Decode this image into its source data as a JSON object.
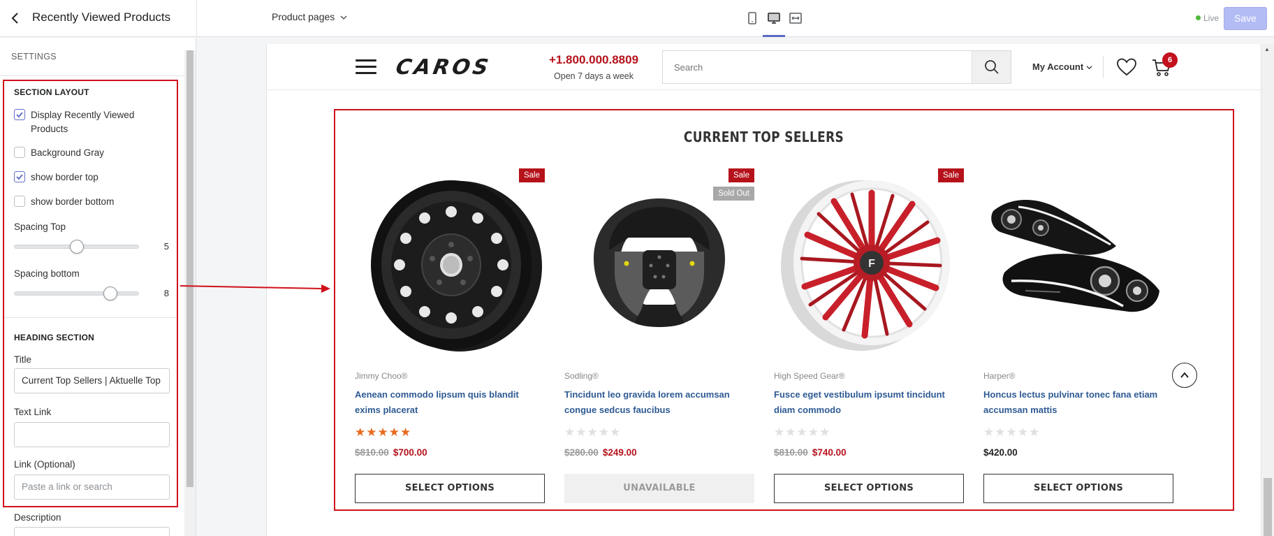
{
  "editor": {
    "panel_title": "Recently Viewed Products",
    "page_selector": "Product pages",
    "status": "Live",
    "save_label": "Save",
    "devices": [
      "mobile-icon",
      "desktop-icon",
      "fullwidth-icon"
    ],
    "active_device": "desktop"
  },
  "sidebar": {
    "heading": "SETTINGS",
    "section_layout": {
      "title": "SECTION LAYOUT",
      "checkboxes": [
        {
          "label_line1": "Display Recently Viewed",
          "label_line2": "Products",
          "checked": true
        },
        {
          "label_line1": "Background Gray",
          "checked": false
        },
        {
          "label_line1": "show border top",
          "checked": true
        },
        {
          "label_line1": "show border bottom",
          "checked": false
        }
      ],
      "spacing_top": {
        "label": "Spacing Top",
        "value": "5"
      },
      "spacing_bottom": {
        "label": "Spacing bottom",
        "value": "8"
      }
    },
    "heading_section": {
      "title": "HEADING SECTION",
      "title_label": "Title",
      "title_value": "Current Top Sellers | Aktuelle Top",
      "text_link_label": "Text Link",
      "text_link_value": "",
      "link_label": "Link (Optional)",
      "link_placeholder": "Paste a link or search",
      "description_label": "Description"
    }
  },
  "store": {
    "logo": "CAROS",
    "phone": "+1.800.000.8809",
    "hours": "Open 7 days a week",
    "search_placeholder": "Search",
    "account_label": "My Account",
    "cart_count": "6"
  },
  "section": {
    "heading": "CURRENT TOP SELLERS",
    "products": [
      {
        "brand": "Jimmy Choo®",
        "name": "Aenean commodo lipsum quis blandit exims placerat",
        "badge_sale": "Sale",
        "badge_status": "",
        "rating": 5,
        "old_price": "$810.00",
        "price": "$700.00",
        "button": "SELECT OPTIONS",
        "available": true
      },
      {
        "brand": "Sodling®",
        "name": "Tincidunt leo gravida lorem accumsan congue sedcus faucibus",
        "badge_sale": "Sale",
        "badge_status": "Sold Out",
        "rating": 0,
        "old_price": "$280.00",
        "price": "$249.00",
        "button": "UNAVAILABLE",
        "available": false
      },
      {
        "brand": "High Speed Gear®",
        "name": "Fusce eget vestibulum ipsumt tincidunt diam commodo",
        "badge_sale": "Sale",
        "badge_status": "",
        "rating": 0,
        "old_price": "$810.00",
        "price": "$740.00",
        "button": "SELECT OPTIONS",
        "available": true
      },
      {
        "brand": "Harper®",
        "name": "Honcus lectus pulvinar tonec fana etiam accumsan mattis",
        "badge_sale": "",
        "badge_status": "",
        "rating": 0,
        "old_price": "",
        "price": "$420.00",
        "button": "SELECT OPTIONS",
        "available": true
      }
    ]
  },
  "colors": {
    "accent_red": "#b5121b",
    "annotation_red": "#d0111b",
    "link_blue": "#2e5a93",
    "star_orange": "#e86a1d",
    "editor_accent": "#5b6ac4"
  }
}
